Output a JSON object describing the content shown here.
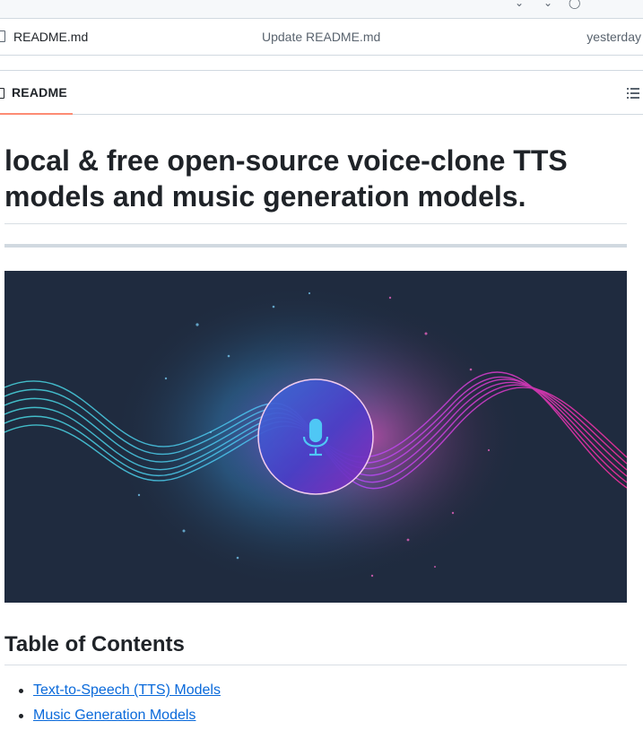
{
  "file_row": {
    "name": "README.md",
    "commit_message": "Update README.md",
    "time": "yesterday"
  },
  "readme_tab": {
    "label": "README"
  },
  "article": {
    "heading": "local & free open-source voice-clone TTS models and music generation models.",
    "banner_icon": "microphone-icon",
    "toc_heading": "Table of Contents",
    "toc_links": [
      {
        "label": "Text-to-Speech (TTS) Models"
      },
      {
        "label": "Music Generation Models"
      }
    ]
  },
  "colors": {
    "link": "#0969da",
    "tab_accent": "#fd8c73",
    "banner_bg": "#1f2b3f",
    "wave_cyan": "#49d8e0",
    "wave_magenta": "#ff2fa0"
  }
}
